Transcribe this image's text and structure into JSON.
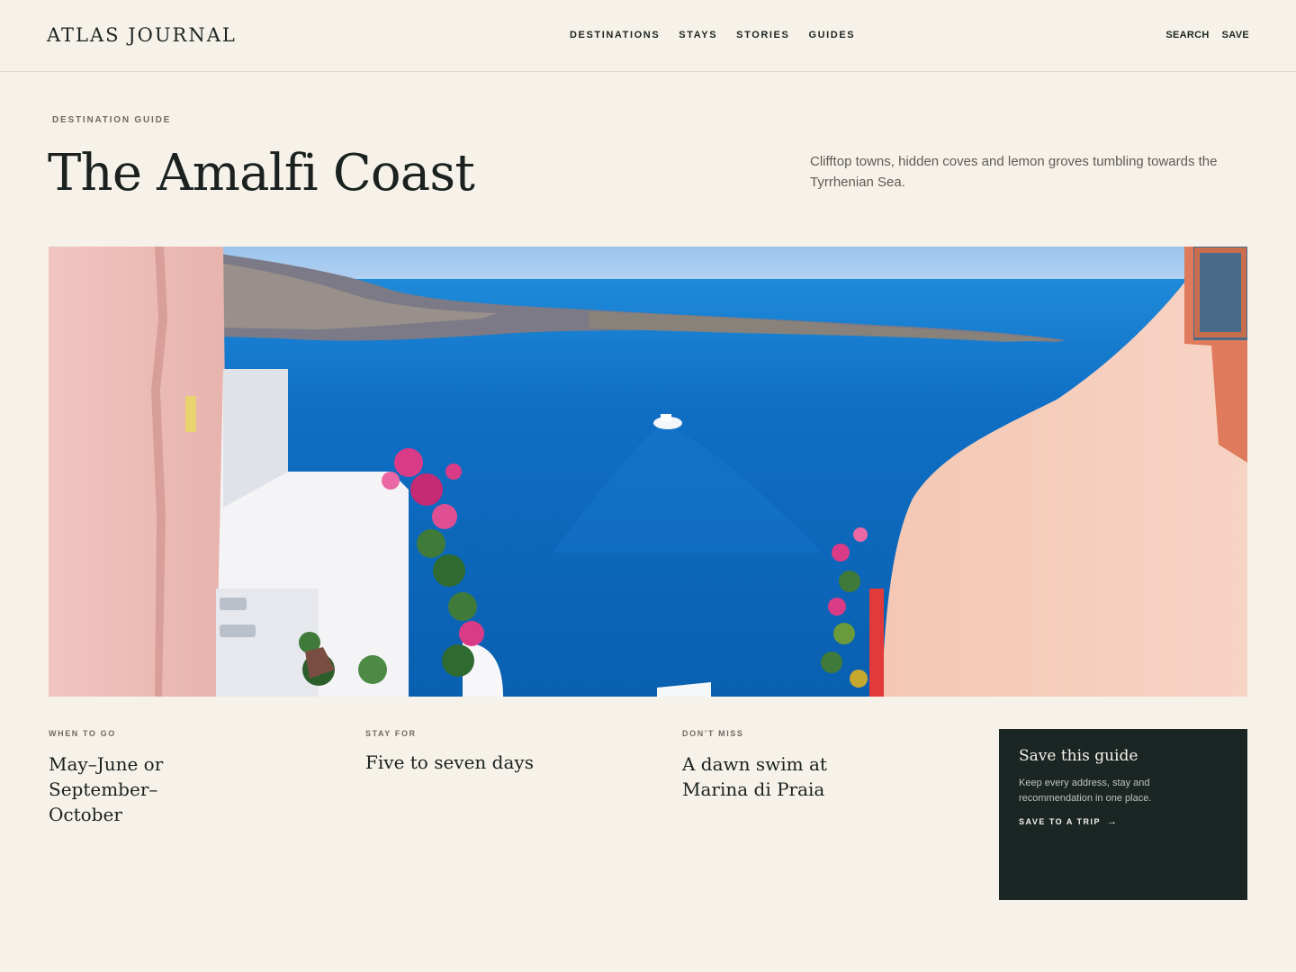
{
  "header": {
    "logo": "ATLAS JOURNAL",
    "nav": [
      {
        "label": "DESTINATIONS"
      },
      {
        "label": "STAYS"
      },
      {
        "label": "STORIES"
      },
      {
        "label": "GUIDES"
      }
    ],
    "utility": {
      "search": "SEARCH",
      "save": "SAVE"
    }
  },
  "hero": {
    "eyebrow": "DESTINATION GUIDE",
    "title": "The Amalfi Coast",
    "intro": "Clifftop towns, hidden coves and lemon groves tumbling towards the Tyrrhenian Sea."
  },
  "facts": [
    {
      "label": "WHEN TO GO",
      "value": "May–June or September–October"
    },
    {
      "label": "STAY FOR",
      "value": "Five to seven days"
    },
    {
      "label": "DON’T MISS",
      "value": "A dawn swim at Marina di Praia"
    }
  ],
  "save_card": {
    "title": "Save this guide",
    "description": "Keep every address, stay and recommendation in one place.",
    "cta": "SAVE TO A TRIP",
    "cta_icon": "arrow-right-icon"
  },
  "colors": {
    "background": "#f6f2ea",
    "ink": "#1c2422",
    "card": "#1b2523",
    "sea": "#0f69bd"
  }
}
